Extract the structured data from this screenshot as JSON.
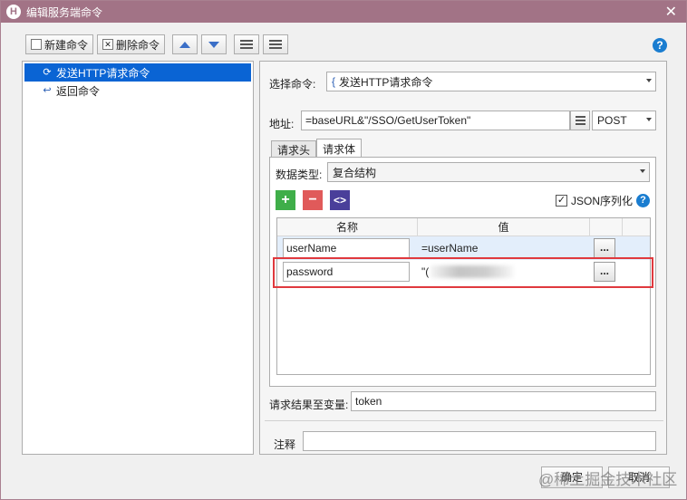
{
  "window": {
    "icon_letter": "H",
    "title": "编辑服务端命令",
    "close_glyph": "✕"
  },
  "toolbar": {
    "new_label": "新建命令",
    "delete_label": "删除命令",
    "help_glyph": "?"
  },
  "commands": [
    {
      "label": "发送HTTP请求命令",
      "selected": true
    },
    {
      "label": "返回命令",
      "selected": false
    }
  ],
  "form": {
    "select_command_label": "选择命令:",
    "select_command_value": "发送HTTP请求命令",
    "address_label": "地址:",
    "address_value": "=baseURL&\"/SSO/GetUserToken\"",
    "method_value": "POST",
    "tabs": [
      "请求头",
      "请求体"
    ],
    "active_tab": 1,
    "data_type_label": "数据类型:",
    "data_type_value": "复合结构",
    "json_serialize_label": "JSON序列化",
    "json_serialize_checked": true,
    "result_var_label": "请求结果至变量:",
    "result_var_value": "token",
    "note_label": "注释",
    "note_value": ""
  },
  "grid": {
    "headers": [
      "名称",
      "值"
    ],
    "rows": [
      {
        "name": "userName",
        "value": "=userName",
        "button": "..."
      },
      {
        "name": "password",
        "value": "\"(",
        "button": "..."
      }
    ]
  },
  "add_glyph": "+",
  "remove_glyph": "−",
  "code_glyph": "<>",
  "footer": {
    "ok_label": "确定",
    "cancel_label": "取消"
  },
  "watermark": "@稀土掘金技术社区",
  "colors": {
    "titlebar": "#a27386",
    "selection": "#0a64d4",
    "highlight_box": "#e0393e",
    "add_button": "#3fae49",
    "remove_button": "#e05a5a",
    "code_button": "#4a3f9a"
  }
}
